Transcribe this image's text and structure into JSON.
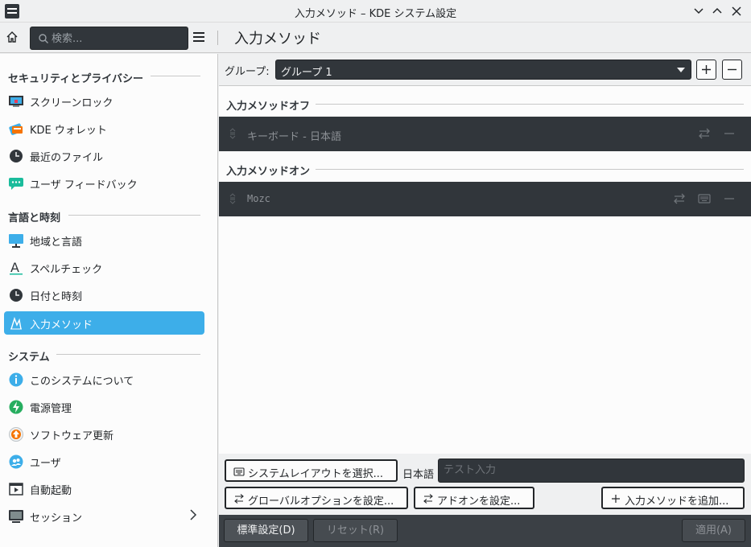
{
  "window": {
    "title": "入力メソッド – KDE システム設定"
  },
  "toolbar": {
    "search_placeholder": "検索...",
    "page_title": "入力メソッド"
  },
  "sidebar": {
    "sections": [
      {
        "header": "セキュリティとプライバシー",
        "items": [
          {
            "label": "スクリーンロック",
            "icon": "screen-lock-icon"
          },
          {
            "label": "KDE ウォレット",
            "icon": "wallet-icon"
          },
          {
            "label": "最近のファイル",
            "icon": "clock-icon"
          },
          {
            "label": "ユーザ フィードバック",
            "icon": "feedback-icon"
          }
        ]
      },
      {
        "header": "言語と時刻",
        "items": [
          {
            "label": "地域と言語",
            "icon": "region-icon"
          },
          {
            "label": "スペルチェック",
            "icon": "spellcheck-icon"
          },
          {
            "label": "日付と時刻",
            "icon": "clock-icon"
          },
          {
            "label": "入力メソッド",
            "icon": "input-method-icon",
            "active": true
          }
        ]
      },
      {
        "header": "システム",
        "items": [
          {
            "label": "このシステムについて",
            "icon": "info-icon"
          },
          {
            "label": "電源管理",
            "icon": "power-icon"
          },
          {
            "label": "ソフトウェア更新",
            "icon": "update-icon"
          },
          {
            "label": "ユーザ",
            "icon": "users-icon"
          },
          {
            "label": "自動起動",
            "icon": "autostart-icon"
          },
          {
            "label": "セッション",
            "icon": "session-icon"
          }
        ]
      }
    ]
  },
  "main": {
    "group_label": "グループ:",
    "group_value": "グループ 1",
    "off_header": "入力メソッドオフ",
    "off_item": "キーボード - 日本語",
    "on_header": "入力メソッドオン",
    "on_item": "Mozc",
    "btn_select_layout": "システムレイアウトを選択...",
    "test_label": "日本語",
    "test_placeholder": "テスト入力",
    "btn_global_options": "グローバルオプションを設定...",
    "btn_addons": "アドオンを設定...",
    "btn_add_im": "入力メソッドを追加..."
  },
  "footer": {
    "defaults": "標準設定(D)",
    "reset": "リセット(R)",
    "apply": "適用(A)"
  },
  "colors": {
    "accent": "#3daee9",
    "dark": "#31363b"
  }
}
